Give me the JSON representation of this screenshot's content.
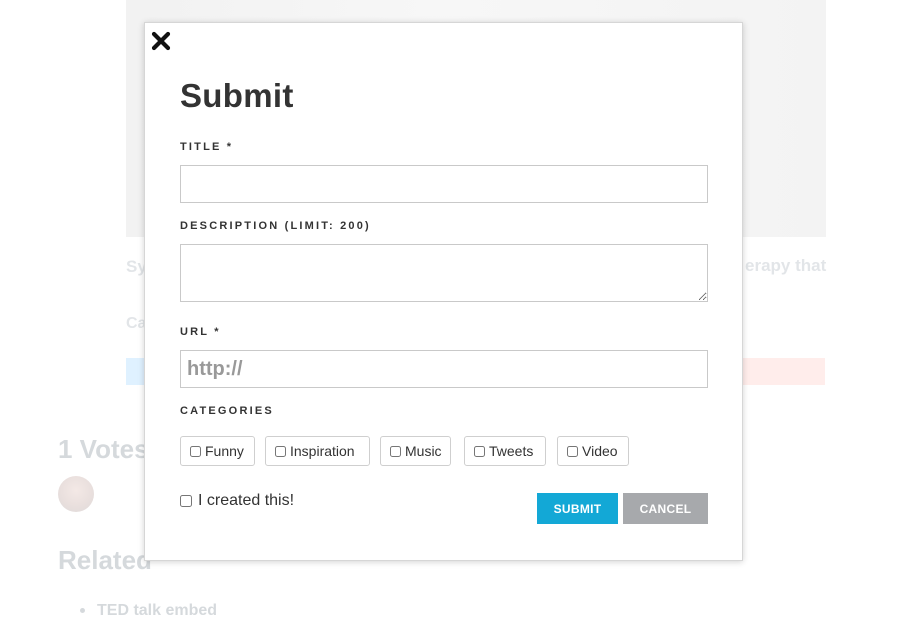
{
  "background": {
    "description_left": "Sy ex",
    "description_right": "erapy that",
    "category_fragment": "Ca",
    "votes_heading": "1 Votes",
    "related_heading": "Related",
    "related_items": [
      "TED talk embed"
    ]
  },
  "modal": {
    "title": "Submit",
    "title_label": "TITLE *",
    "title_value": "",
    "description_label": "DESCRIPTION (LIMIT: 200)",
    "description_value": "",
    "url_label": "URL *",
    "url_placeholder": "http://",
    "categories_label": "CATEGORIES",
    "categories": [
      {
        "label": "Funny",
        "checked": false
      },
      {
        "label": "Inspiration",
        "checked": false
      },
      {
        "label": "Music",
        "checked": false
      },
      {
        "label": "Tweets",
        "checked": false
      },
      {
        "label": "Video",
        "checked": false
      }
    ],
    "created_label": "I created this!",
    "submit_label": "SUBMIT",
    "cancel_label": "CANCEL"
  },
  "colors": {
    "submit": "#13a8d6",
    "cancel": "#a7a9ac"
  },
  "icons": {
    "close": "close-icon"
  }
}
